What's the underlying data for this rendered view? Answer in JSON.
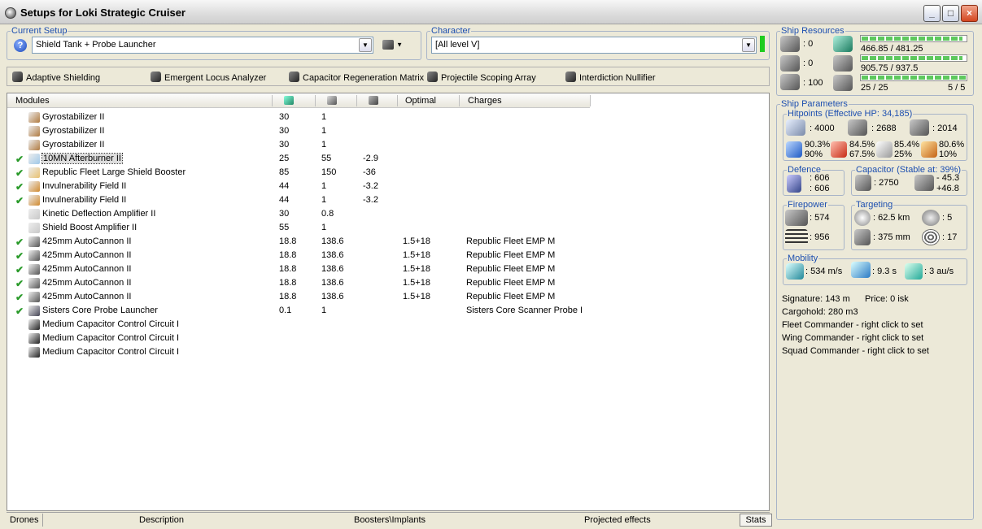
{
  "window": {
    "title": "Setups for Loki Strategic Cruiser",
    "minimize": "_",
    "maximize": "□",
    "close": "×"
  },
  "current_setup": {
    "legend": "Current Setup",
    "value": "Shield Tank + Probe Launcher"
  },
  "character": {
    "legend": "Character",
    "value": "[All level V]"
  },
  "subsystems": [
    "Adaptive Shielding",
    "Emergent Locus Analyzer",
    "Capacitor Regeneration Matrix",
    "Projectile Scoping Array",
    "Interdiction Nullifier"
  ],
  "modules_header": {
    "name": "Modules",
    "optimal": "Optimal",
    "charges": "Charges"
  },
  "modules": [
    {
      "checked": false,
      "name": "Gyrostabilizer II",
      "cpu": "30",
      "pg": "1",
      "cap": "",
      "optimal": "",
      "charges": ""
    },
    {
      "checked": false,
      "name": "Gyrostabilizer II",
      "cpu": "30",
      "pg": "1",
      "cap": "",
      "optimal": "",
      "charges": ""
    },
    {
      "checked": false,
      "name": "Gyrostabilizer II",
      "cpu": "30",
      "pg": "1",
      "cap": "",
      "optimal": "",
      "charges": ""
    },
    {
      "checked": true,
      "name": "10MN Afterburner II",
      "cpu": "25",
      "pg": "55",
      "cap": "-2.9",
      "optimal": "",
      "charges": ""
    },
    {
      "checked": true,
      "name": "Republic Fleet Large Shield Booster",
      "cpu": "85",
      "pg": "150",
      "cap": "-36",
      "optimal": "",
      "charges": ""
    },
    {
      "checked": true,
      "name": "Invulnerability Field II",
      "cpu": "44",
      "pg": "1",
      "cap": "-3.2",
      "optimal": "",
      "charges": ""
    },
    {
      "checked": true,
      "name": "Invulnerability Field II",
      "cpu": "44",
      "pg": "1",
      "cap": "-3.2",
      "optimal": "",
      "charges": ""
    },
    {
      "checked": false,
      "name": "Kinetic Deflection Amplifier II",
      "cpu": "30",
      "pg": "0.8",
      "cap": "",
      "optimal": "",
      "charges": ""
    },
    {
      "checked": false,
      "name": "Shield Boost Amplifier II",
      "cpu": "55",
      "pg": "1",
      "cap": "",
      "optimal": "",
      "charges": ""
    },
    {
      "checked": true,
      "name": "425mm AutoCannon II",
      "cpu": "18.8",
      "pg": "138.6",
      "cap": "",
      "optimal": "1.5+18",
      "charges": "Republic Fleet EMP M"
    },
    {
      "checked": true,
      "name": "425mm AutoCannon II",
      "cpu": "18.8",
      "pg": "138.6",
      "cap": "",
      "optimal": "1.5+18",
      "charges": "Republic Fleet EMP M"
    },
    {
      "checked": true,
      "name": "425mm AutoCannon II",
      "cpu": "18.8",
      "pg": "138.6",
      "cap": "",
      "optimal": "1.5+18",
      "charges": "Republic Fleet EMP M"
    },
    {
      "checked": true,
      "name": "425mm AutoCannon II",
      "cpu": "18.8",
      "pg": "138.6",
      "cap": "",
      "optimal": "1.5+18",
      "charges": "Republic Fleet EMP M"
    },
    {
      "checked": true,
      "name": "425mm AutoCannon II",
      "cpu": "18.8",
      "pg": "138.6",
      "cap": "",
      "optimal": "1.5+18",
      "charges": "Republic Fleet EMP M"
    },
    {
      "checked": true,
      "name": "Sisters Core Probe Launcher",
      "cpu": "0.1",
      "pg": "1",
      "cap": "",
      "optimal": "",
      "charges": "Sisters Core Scanner Probe I"
    },
    {
      "checked": false,
      "name": "Medium Capacitor Control Circuit I",
      "cpu": "",
      "pg": "",
      "cap": "",
      "optimal": "",
      "charges": ""
    },
    {
      "checked": false,
      "name": "Medium Capacitor Control Circuit I",
      "cpu": "",
      "pg": "",
      "cap": "",
      "optimal": "",
      "charges": ""
    },
    {
      "checked": false,
      "name": "Medium Capacitor Control Circuit I",
      "cpu": "",
      "pg": "",
      "cap": "",
      "optimal": "",
      "charges": ""
    }
  ],
  "bottom_tabs": {
    "drones": "Drones",
    "description": "Description",
    "boosters": "Boosters\\Implants",
    "projected": "Projected effects",
    "stats": "Stats"
  },
  "resources": {
    "legend": "Ship Resources",
    "hardpoints": [
      ": 0",
      ": 0",
      ": 100"
    ],
    "cpu": {
      "text": "466.85 / 481.25",
      "fraction": 0.97
    },
    "powergrid": {
      "text": "905.75 / 937.5",
      "fraction": 0.966
    },
    "calibration": {
      "text": "25 / 25",
      "fraction": 1.0
    },
    "slots": "5 / 5"
  },
  "params": {
    "legend": "Ship Parameters",
    "hitpoints": {
      "legend": "Hitpoints (Effective HP: 34,185)",
      "shield": ": 4000",
      "armor": ": 2688",
      "structure": ": 2014",
      "res_a1": "90.3%",
      "res_a2": "90%",
      "res_b1": "84.5%",
      "res_b2": "67.5%",
      "res_c1": "85.4%",
      "res_c2": "25%",
      "res_d1": "80.6%",
      "res_d2": "10%"
    },
    "defence": {
      "legend": "Defence",
      "v1": ": 606",
      "v2": ": 606"
    },
    "capacitor": {
      "legend": "Capacitor (Stable at: 39%)",
      "amount": ": 2750",
      "v1": "- 45.3",
      "v2": "+46.8"
    },
    "firepower": {
      "legend": "Firepower",
      "v1": ": 574",
      "v2": ": 956"
    },
    "targeting": {
      "legend": "Targeting",
      "range": ": 62.5 km",
      "targets": ": 5",
      "resolution": ": 375 mm",
      "sensor": ": 17"
    },
    "mobility": {
      "legend": "Mobility",
      "speed": ": 534 m/s",
      "align": ": 9.3 s",
      "warp": ": 3 au/s"
    },
    "signature": "Signature: 143 m",
    "price": "Price: 0 isk",
    "cargohold": "Cargohold: 280 m3",
    "fleet_commander": "Fleet Commander - right click to set",
    "wing_commander": "Wing Commander - right click to set",
    "squad_commander": "Squad Commander - right click to set"
  }
}
